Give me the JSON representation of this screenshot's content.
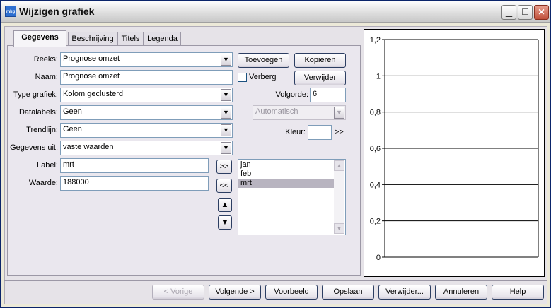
{
  "window": {
    "title": "Wijzigen grafiek",
    "app_icon_text": "mkg",
    "minimize_glyph": "▁",
    "maximize_glyph": "☐",
    "close_glyph": "✕"
  },
  "tabs": [
    {
      "label": "Gegevens",
      "active": true
    },
    {
      "label": "Beschrijving",
      "active": false
    },
    {
      "label": "Titels",
      "active": false
    },
    {
      "label": "Legenda",
      "active": false
    }
  ],
  "form": {
    "reeks_label": "Reeks:",
    "reeks_value": "Prognose omzet",
    "naam_label": "Naam:",
    "naam_value": "Prognose omzet",
    "type_label": "Type grafiek:",
    "type_value": "Kolom geclusterd",
    "datalabels_label": "Datalabels:",
    "datalabels_value": "Geen",
    "trendlijn_label": "Trendlijn:",
    "trendlijn_value": "Geen",
    "gegevens_uit_label": "Gegevens uit:",
    "gegevens_uit_value": "vaste waarden",
    "label_label": "Label:",
    "label_value": "mrt",
    "waarde_label": "Waarde:",
    "waarde_value": "188000",
    "toevoegen": "Toevoegen",
    "kopieren": "Kopieren",
    "verberg_label": "Verberg",
    "verberg_checked": false,
    "verwijder": "Verwijder",
    "volgorde_label": "Volgorde:",
    "volgorde_value": "6",
    "automatisch_value": "Automatisch",
    "kleur_label": "Kleur:",
    "kleur_more": ">>",
    "move_right": ">>",
    "move_left": "<<",
    "up_glyph": "▲",
    "down_glyph": "▼",
    "list_items": [
      {
        "label": "jan",
        "selected": false
      },
      {
        "label": "feb",
        "selected": false
      },
      {
        "label": "mrt",
        "selected": true
      }
    ]
  },
  "chart_data": {
    "type": "bar",
    "categories": [],
    "values": [],
    "title": "",
    "xlabel": "",
    "ylabel": "",
    "ylim": [
      0,
      1.2
    ],
    "yticks": [
      "0",
      "0,2",
      "0,4",
      "0,6",
      "0,8",
      "1",
      "1,2"
    ],
    "grid": true
  },
  "footer": {
    "vorige": "< Vorige",
    "volgende": "Volgende >",
    "voorbeeld": "Voorbeeld",
    "opslaan": "Opslaan",
    "verwijder": "Verwijder...",
    "annuleren": "Annuleren",
    "help": "Help"
  }
}
